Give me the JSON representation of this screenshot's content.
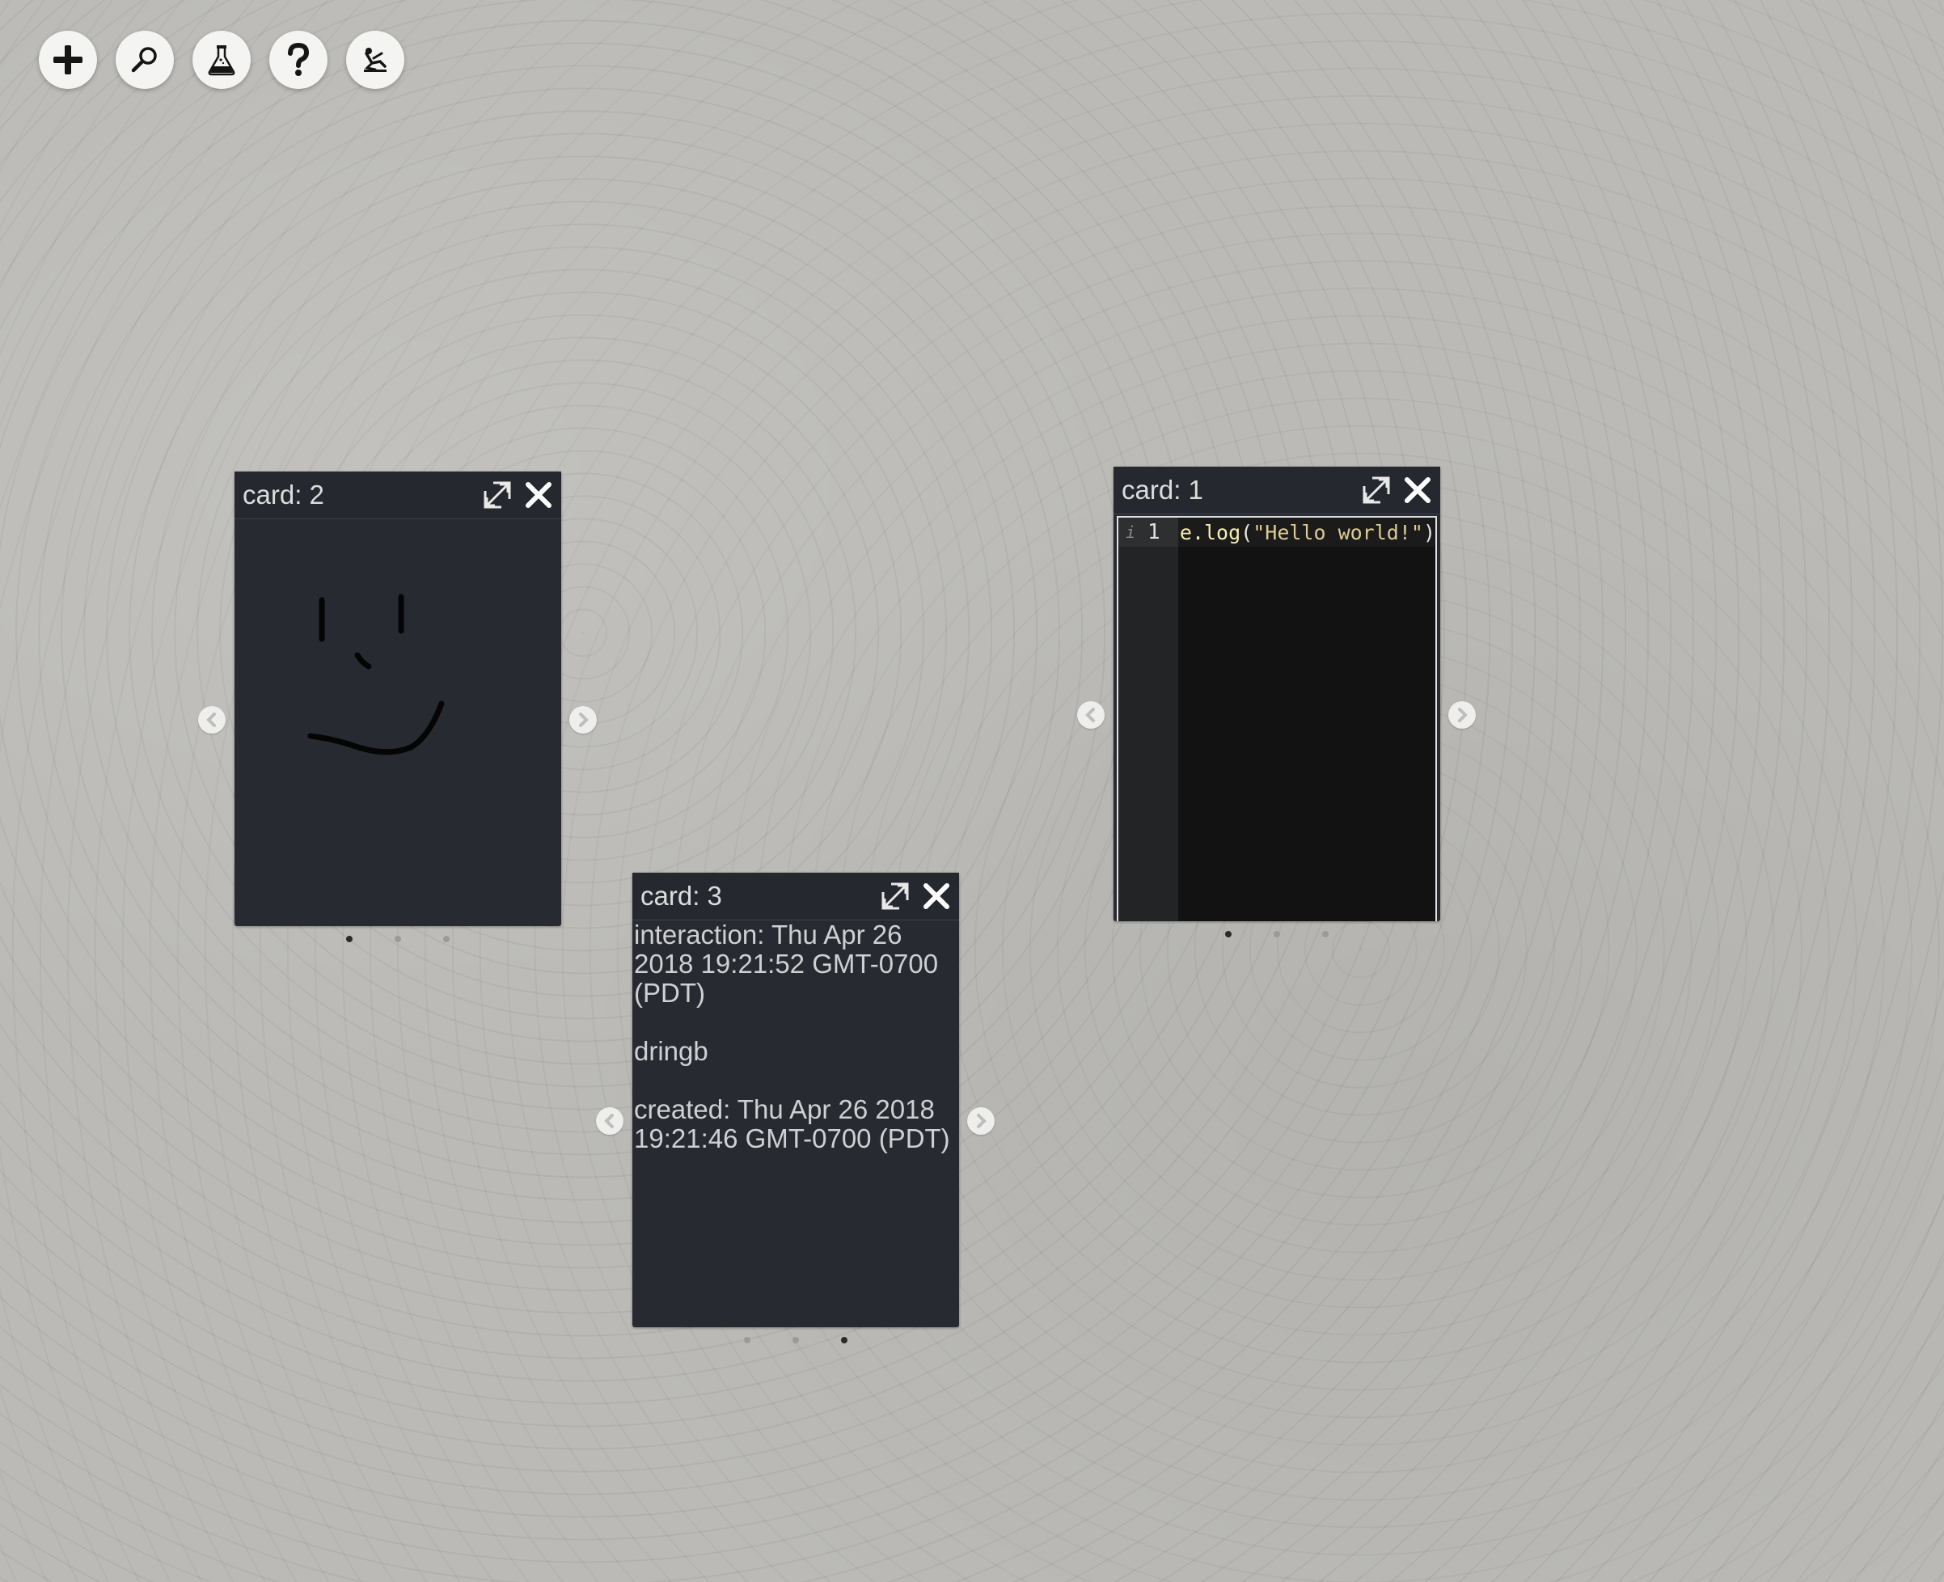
{
  "toolbar": {
    "buttons": [
      {
        "name": "add-button",
        "icon": "plus-icon"
      },
      {
        "name": "search-button",
        "icon": "magnifier-icon"
      },
      {
        "name": "lab-button",
        "icon": "flask-icon"
      },
      {
        "name": "help-button",
        "icon": "question-icon"
      },
      {
        "name": "user-button",
        "icon": "skydiver-icon"
      }
    ]
  },
  "cards": {
    "card2": {
      "title": "card: 2",
      "active_page": 1,
      "pages": 3
    },
    "card1": {
      "title": "card: 1",
      "active_page": 1,
      "pages": 3,
      "editor": {
        "line_number": "1",
        "info_marker": "i",
        "code": {
          "prefix": "e.",
          "fn": "log",
          "open": "(",
          "str": "\"Hello world!\"",
          "close": ")"
        }
      }
    },
    "card3": {
      "title": "card: 3",
      "active_page": 3,
      "pages": 3,
      "interaction": "interaction: Thu Apr 26 2018 19:21:52 GMT-0700 (PDT)",
      "user": "dringb",
      "created": "created: Thu Apr 26 2018 19:21:46 GMT-0700 (PDT)"
    }
  },
  "colors": {
    "background": "#bbbab6",
    "card": "#272a31",
    "editor_bg": "#121212"
  }
}
